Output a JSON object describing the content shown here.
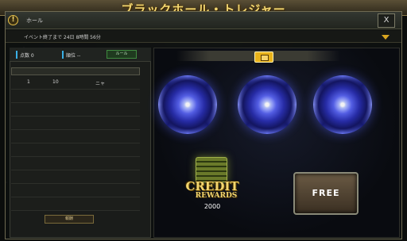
{
  "window": {
    "title": "ブラックホール・トレジャー",
    "tab_label": "ホール",
    "close_label": "X"
  },
  "event": {
    "remaining": "イベント終了まで 24日 8時間 56分"
  },
  "stats": {
    "points_label": "点数 0",
    "rank_label": "順位 --",
    "detail_button": "ルール"
  },
  "ranking": {
    "rows": [
      {
        "rank": "1",
        "points": "10",
        "name": "ニャ"
      },
      {
        "rank": "",
        "points": "",
        "name": ""
      },
      {
        "rank": "",
        "points": "",
        "name": ""
      },
      {
        "rank": "",
        "points": "",
        "name": ""
      },
      {
        "rank": "",
        "points": "",
        "name": ""
      },
      {
        "rank": "",
        "points": "",
        "name": ""
      },
      {
        "rank": "",
        "points": "",
        "name": ""
      },
      {
        "rank": "",
        "points": "",
        "name": ""
      },
      {
        "rank": "",
        "points": "",
        "name": ""
      },
      {
        "rank": "",
        "points": "",
        "name": ""
      }
    ],
    "footer_button": "報酬"
  },
  "rewards": {
    "credit_line1": "CREDIT",
    "credit_line2": "REWARDS",
    "credit_amount": "2000"
  },
  "action": {
    "free_button": "FREE"
  },
  "colors": {
    "accent_gold": "#f2d670",
    "stat_bar_blue": "#3ab0e6",
    "vortex_blue": "#5a63d8"
  },
  "icons": [
    "info-icon",
    "close-icon",
    "chevron-down-icon",
    "treasure-chest-icon",
    "blackhole-icon",
    "credit-icon"
  ]
}
